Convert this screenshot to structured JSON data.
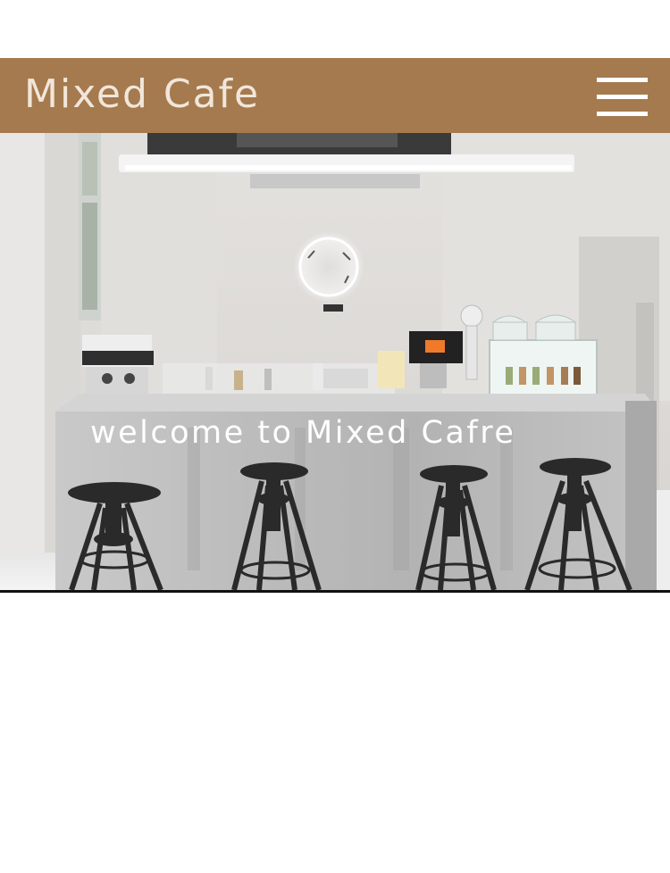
{
  "header": {
    "title": "Mixed Cafe",
    "menu_icon": "hamburger-menu-icon",
    "background_color": "#a57a4e"
  },
  "hero": {
    "image_subject": "cafe-counter-photo",
    "welcome_text": "welcome to Mixed Cafre"
  }
}
